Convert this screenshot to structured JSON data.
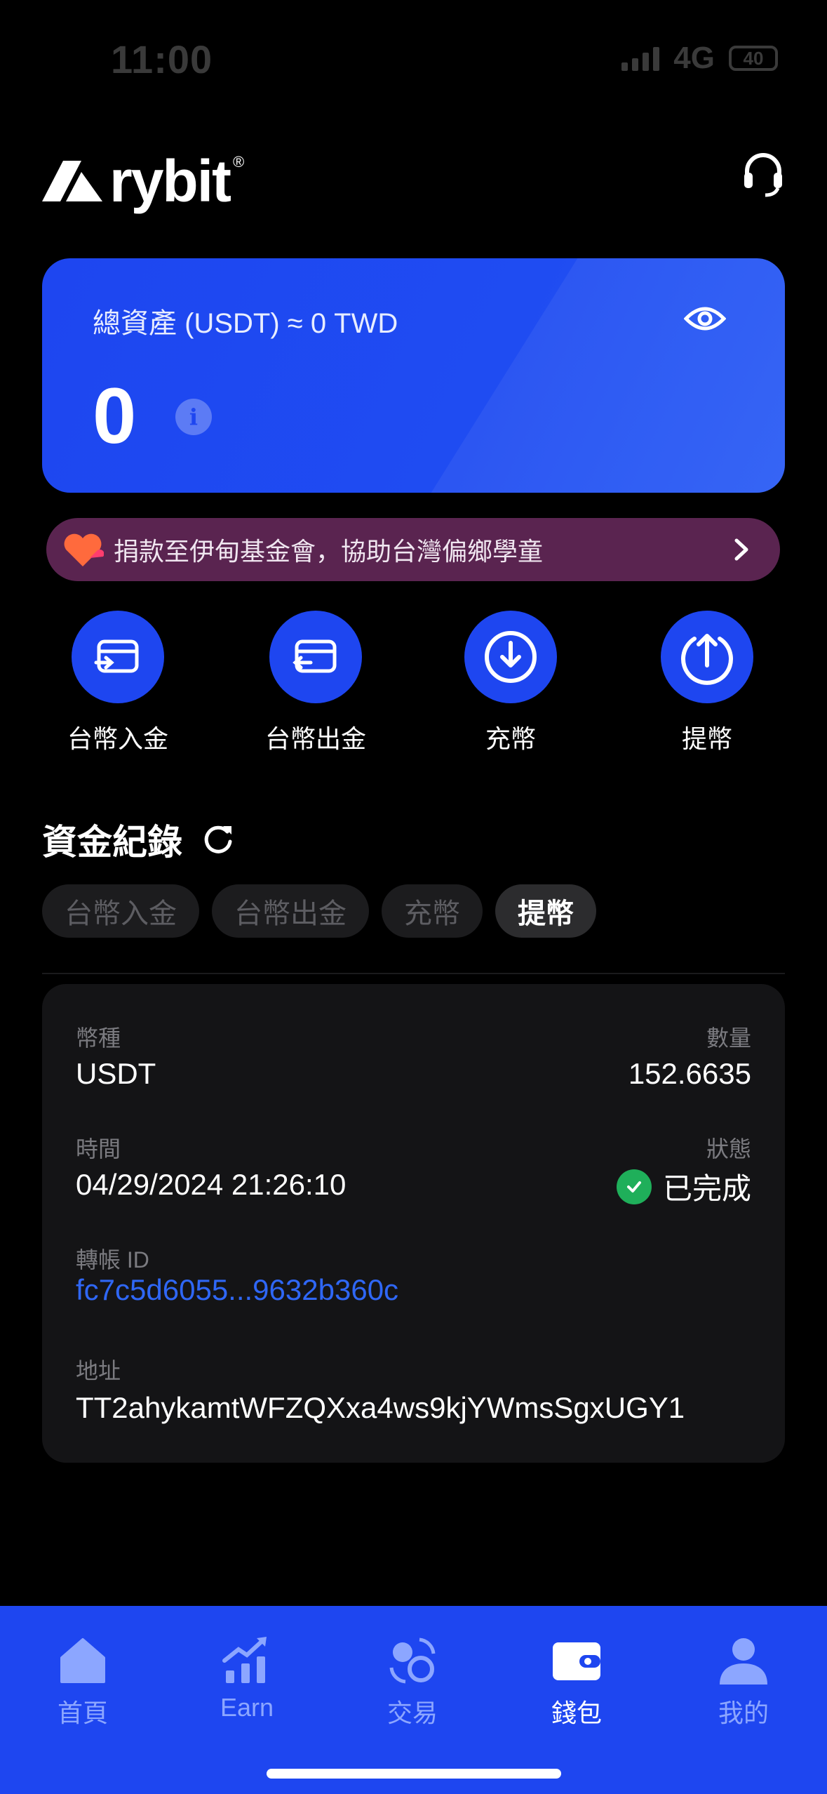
{
  "status_bar": {
    "time": "11:00",
    "network": "4G",
    "battery": "40"
  },
  "header": {
    "logo_text": "rybit",
    "logo_mark": "®",
    "support_icon": "headset-icon"
  },
  "balance_card": {
    "label": "總資產 (USDT) ≈ 0 TWD",
    "value": "0",
    "info_glyph": "i",
    "eye_icon": "eye-icon"
  },
  "banner": {
    "text": "捐款至伊甸基金會，協助台灣偏鄉學童",
    "icon": "heart-icon"
  },
  "actions": [
    {
      "label": "台幣入金",
      "icon": "card-in-icon"
    },
    {
      "label": "台幣出金",
      "icon": "card-out-icon"
    },
    {
      "label": "充幣",
      "icon": "deposit-icon"
    },
    {
      "label": "提幣",
      "icon": "withdraw-icon"
    }
  ],
  "records": {
    "title": "資金紀錄",
    "tabs": [
      "台幣入金",
      "台幣出金",
      "充幣",
      "提幣"
    ],
    "active_tab": "提幣",
    "entry": {
      "coin_label": "幣種",
      "coin_value": "USDT",
      "amount_label": "數量",
      "amount_value": "152.6635",
      "time_label": "時間",
      "time_value": "04/29/2024 21:26:10",
      "status_label": "狀態",
      "status_value": "已完成",
      "txid_label": "轉帳 ID",
      "txid_value": "fc7c5d6055...9632b360c",
      "address_label": "地址",
      "address_value": "TT2ahykamtWFZQXxa4ws9kjYWmsSgxUGY1"
    }
  },
  "tabbar": {
    "items": [
      {
        "label": "首頁",
        "icon": "home-icon"
      },
      {
        "label": "Earn",
        "icon": "chart-icon"
      },
      {
        "label": "交易",
        "icon": "exchange-icon"
      },
      {
        "label": "錢包",
        "icon": "wallet-icon",
        "active": true
      },
      {
        "label": "我的",
        "icon": "user-icon"
      }
    ]
  },
  "colors": {
    "accent": "#1e46f0",
    "banner": "#5a2450",
    "success": "#1faf5a",
    "link": "#2f67f6"
  }
}
